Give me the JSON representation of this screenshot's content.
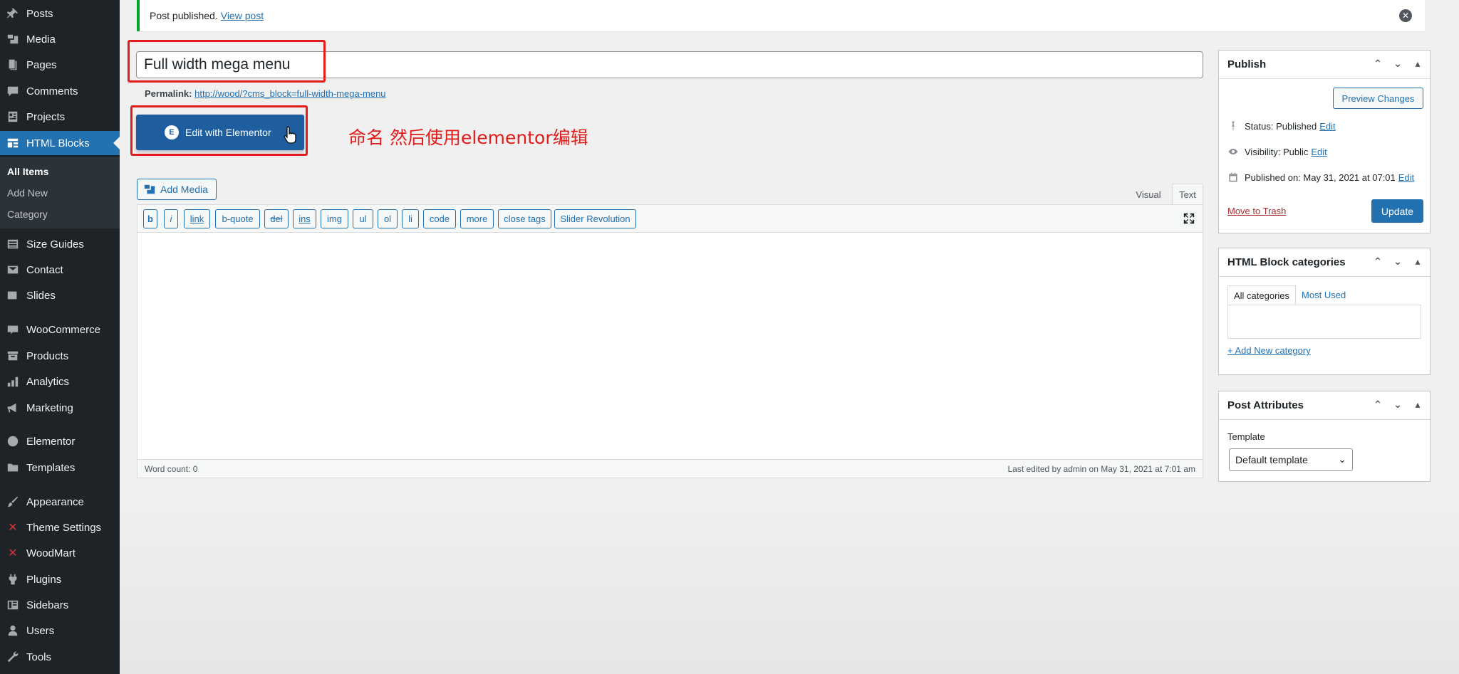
{
  "sidebar": {
    "items": [
      {
        "label": "Posts",
        "icon": "pin-icon"
      },
      {
        "label": "Media",
        "icon": "media-icon"
      },
      {
        "label": "Pages",
        "icon": "pages-icon"
      },
      {
        "label": "Comments",
        "icon": "comment-icon"
      },
      {
        "label": "Projects",
        "icon": "portfolio-icon"
      },
      {
        "label": "HTML Blocks",
        "icon": "blocks-icon"
      },
      {
        "label": "Size Guides",
        "icon": "table-icon"
      },
      {
        "label": "Contact",
        "icon": "mail-icon"
      },
      {
        "label": "Slides",
        "icon": "slides-icon"
      },
      {
        "label": "WooCommerce",
        "icon": "woo-icon"
      },
      {
        "label": "Products",
        "icon": "archive-icon"
      },
      {
        "label": "Analytics",
        "icon": "chart-icon"
      },
      {
        "label": "Marketing",
        "icon": "megaphone-icon"
      },
      {
        "label": "Elementor",
        "icon": "elementor-icon"
      },
      {
        "label": "Templates",
        "icon": "folder-icon"
      },
      {
        "label": "Appearance",
        "icon": "brush-icon"
      },
      {
        "label": "Theme Settings",
        "icon": "x-icon"
      },
      {
        "label": "WoodMart",
        "icon": "x-icon"
      },
      {
        "label": "Plugins",
        "icon": "plugin-icon"
      },
      {
        "label": "Sidebars",
        "icon": "sidebar-icon"
      },
      {
        "label": "Users",
        "icon": "user-icon"
      },
      {
        "label": "Tools",
        "icon": "wrench-icon"
      }
    ],
    "submenu": [
      "All Items",
      "Add New",
      "Category"
    ]
  },
  "notice": {
    "text": "Post published.",
    "link": "View post"
  },
  "title": {
    "value": "Full width mega menu"
  },
  "permalink": {
    "label": "Permalink:",
    "url": "http://wood/?cms_block=full-width-mega-menu"
  },
  "elementor_button": {
    "label": "Edit with Elementor"
  },
  "annotation": "命名 然后使用elementor编辑",
  "editor": {
    "add_media": "Add Media",
    "tab_visual": "Visual",
    "tab_text": "Text",
    "quicktags": [
      "b",
      "i",
      "link",
      "b-quote",
      "del",
      "ins",
      "img",
      "ul",
      "ol",
      "li",
      "code",
      "more",
      "close tags",
      "Slider Revolution"
    ],
    "word_count": "Word count: 0",
    "last_edited": "Last edited by admin on May 31, 2021 at 7:01 am"
  },
  "publish": {
    "title": "Publish",
    "preview": "Preview Changes",
    "status_label": "Status: Published",
    "visibility_label": "Visibility: Public",
    "published_on": "Published on: May 31, 2021 at 07:01",
    "edit": "Edit",
    "trash": "Move to Trash",
    "update": "Update"
  },
  "categories": {
    "title": "HTML Block categories",
    "tab_all": "All categories",
    "tab_most": "Most Used",
    "add_new": "+ Add New category"
  },
  "attributes": {
    "title": "Post Attributes",
    "template_label": "Template",
    "template_value": "Default template"
  },
  "colors": {
    "accent": "#2271b1",
    "sidebar": "#1d2327",
    "annotation": "#e41b1b"
  }
}
